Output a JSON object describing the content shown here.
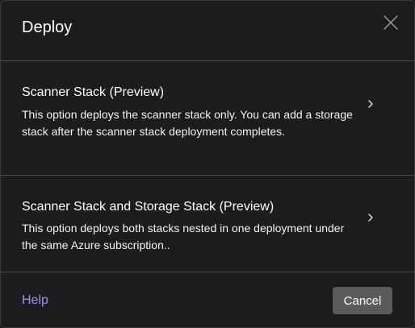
{
  "dialog": {
    "title": "Deploy",
    "close_icon": "close-icon"
  },
  "options": [
    {
      "title": "Scanner Stack (Preview)",
      "description": "This option deploys the scanner stack only. You can add a storage stack after the scanner stack deployment completes.",
      "icon": "chevron-right-icon"
    },
    {
      "title": "Scanner Stack and Storage Stack (Preview)",
      "description": "This option deploys both stacks nested in one deployment under the same Azure subscription..",
      "icon": "chevron-right-icon"
    }
  ],
  "footer": {
    "help_label": "Help",
    "cancel_label": "Cancel"
  },
  "colors": {
    "background": "#1c1c1e",
    "divider": "#4a4a4c",
    "link": "#a98bf0",
    "button": "#5b5b5e"
  }
}
